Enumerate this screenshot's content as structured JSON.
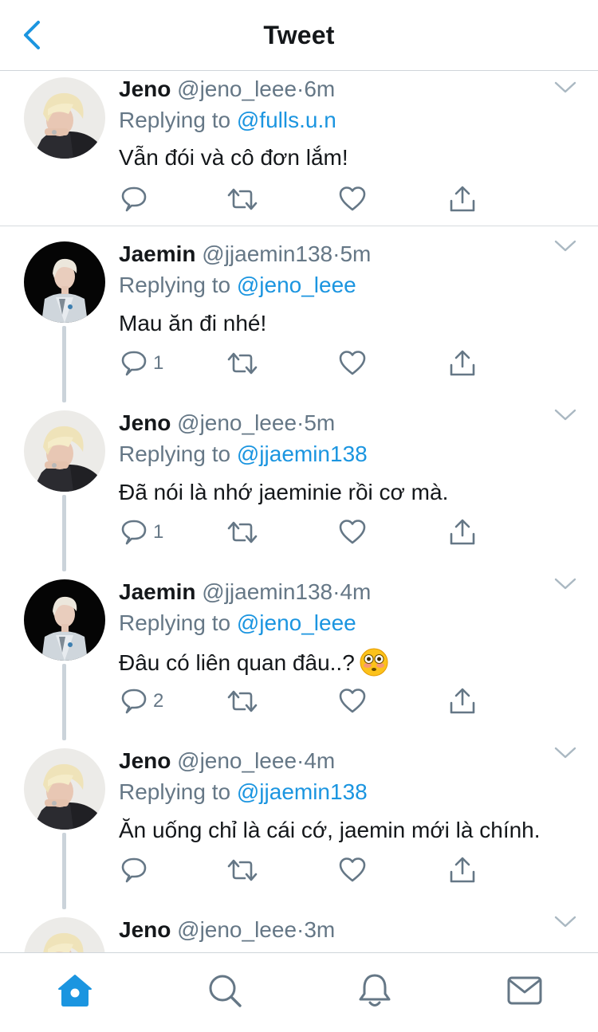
{
  "header": {
    "title": "Tweet"
  },
  "tweets": [
    {
      "name": "Jeno",
      "handle": "@jeno_leee",
      "sep": "·",
      "time": "6m",
      "replying_prefix": "Replying to",
      "replying_to": "@fulls.u.n",
      "text": "Vẫn đói và cô đơn lắm!",
      "reply_count": ""
    },
    {
      "name": "Jaemin",
      "handle": "@jjaemin138",
      "sep": "·",
      "time": "5m",
      "replying_prefix": "Replying to",
      "replying_to": "@jeno_leee",
      "text": "Mau ăn đi nhé!",
      "reply_count": "1"
    },
    {
      "name": "Jeno",
      "handle": "@jeno_leee",
      "sep": "·",
      "time": "5m",
      "replying_prefix": "Replying to",
      "replying_to": "@jjaemin138",
      "text": "Đã nói là nhớ jaeminie rồi cơ mà.",
      "reply_count": "1"
    },
    {
      "name": "Jaemin",
      "handle": "@jjaemin138",
      "sep": "·",
      "time": "4m",
      "replying_prefix": "Replying to",
      "replying_to": "@jeno_leee",
      "text": "Đâu có liên quan đâu..?",
      "emoji": "flushed-face",
      "reply_count": "2"
    },
    {
      "name": "Jeno",
      "handle": "@jeno_leee",
      "sep": "·",
      "time": "4m",
      "replying_prefix": "Replying to",
      "replying_to": "@jjaemin138",
      "text": "Ăn uống chỉ là cái cớ, jaemin mới là chính.",
      "reply_count": ""
    },
    {
      "name": "Jeno",
      "handle": "@jeno_leee",
      "sep": "·",
      "time": "3m"
    }
  ],
  "tabbar": {
    "items": [
      {
        "icon": "home-icon",
        "active": true
      },
      {
        "icon": "search-icon",
        "active": false
      },
      {
        "icon": "bell-icon",
        "active": false
      },
      {
        "icon": "mail-icon",
        "active": false
      }
    ]
  },
  "colors": {
    "accent": "#1b95e0",
    "muted": "#657786",
    "icon_gray": "#657786",
    "divider": "#cfd5da",
    "thread_line": "#cbd3da"
  }
}
